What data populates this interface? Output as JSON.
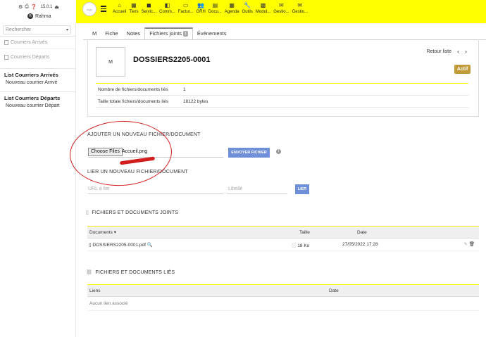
{
  "left_header": {
    "version": "15.0.1",
    "user": "Rahma",
    "user_initial": "R"
  },
  "sidebar": {
    "search_placeholder": "Rechercher",
    "gray_items": [
      "Courriers Arrivés",
      "Courriers Départs"
    ],
    "sections": [
      {
        "title": "List Courriers Arrivés",
        "sub": "Nouveau courrier Arrivé"
      },
      {
        "title": "List Courriers Départs",
        "sub": "Nouveau courrier Départ"
      }
    ]
  },
  "topbar": {
    "logo_text": "logo",
    "nav": [
      "Accueil",
      "Tiers",
      "Servic...",
      "Comm...",
      "Factur...",
      "GRH",
      "Docu...",
      "Agenda",
      "Outils",
      "Modul...",
      "Gestio...",
      "Gestio..."
    ]
  },
  "tabs": {
    "first": "M",
    "fiche": "Fiche",
    "notes": "Notes",
    "joined": "Fichiers joints",
    "joined_count": "1",
    "events": "Événements"
  },
  "card": {
    "thumb_letter": "M",
    "ref": "DOSSIERS2205-0001",
    "back": "Retour liste",
    "prev": "‹",
    "next": "›",
    "status": "Actif",
    "rows": [
      {
        "k": "Nombre de fichiers/documents liés",
        "v": "1"
      },
      {
        "k": "Taille totale fichiers/documents liés",
        "v": "18122 bytes"
      }
    ]
  },
  "upload": {
    "title": "AJOUTER UN NOUVEAU FICHIER/DOCUMENT",
    "choose": "Choose Files",
    "filename": "Accueil.png",
    "send": "ENVOYER FICHIER",
    "info": "i"
  },
  "link": {
    "title": "LIER UN NOUVEAU FICHIER/DOCUMENT",
    "url_placeholder": "URL à lier",
    "label_placeholder": "Libellé",
    "button": "LIER"
  },
  "docs": {
    "title": "FICHIERS ET DOCUMENTS JOINTS",
    "headers": {
      "documents": "Documents",
      "taille": "Taille",
      "date": "Date"
    },
    "row": {
      "name": "DOSSIERS2205-0001.pdf",
      "size": "18 Ko",
      "date": "27/05/2022 17:28"
    }
  },
  "links": {
    "title": "FICHIERS ET DOCUMENTS LIÉS",
    "headers": {
      "liens": "Liens",
      "date": "Date"
    },
    "empty": "Aucun lien associé"
  }
}
